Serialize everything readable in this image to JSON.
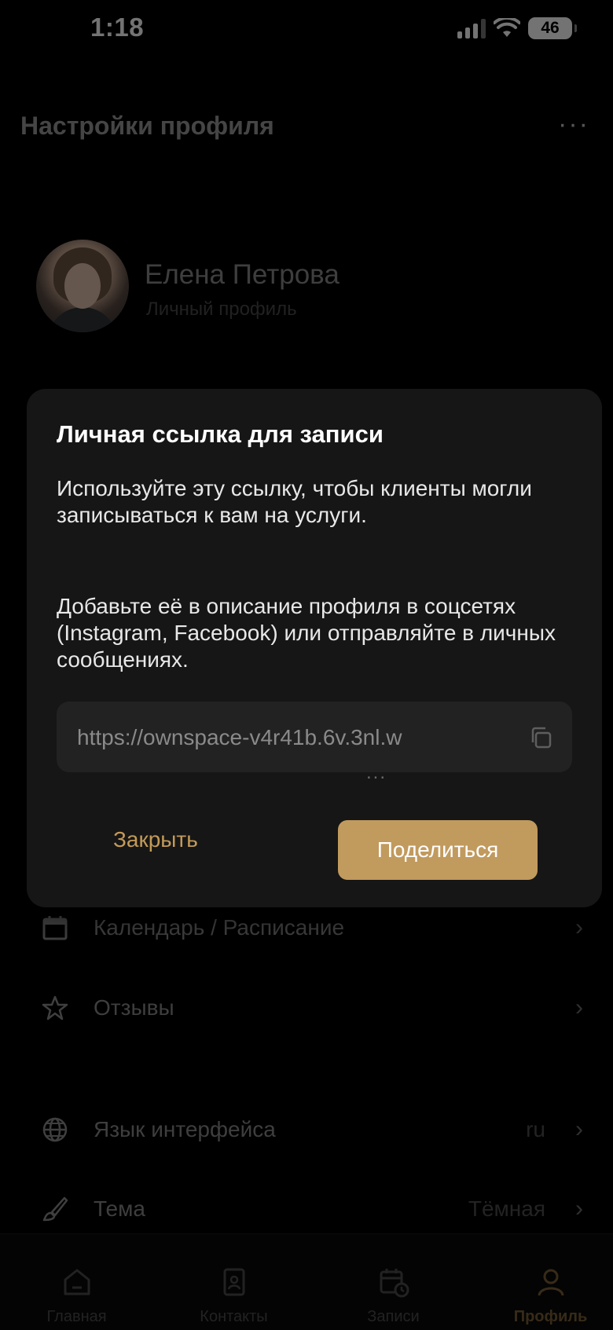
{
  "status": {
    "time": "1:18",
    "battery": "46"
  },
  "header": {
    "title": "Настройки профиля",
    "more": "···"
  },
  "profile": {
    "name": "Елена Петрова",
    "subtitle": "Личный профиль"
  },
  "menu": [
    {
      "label": "Календарь  / Расписание",
      "value": "",
      "icon": "calendar-icon"
    },
    {
      "label": "Отзывы",
      "value": "",
      "icon": "star-icon"
    },
    {
      "label": "Язык интерфейса",
      "value": "ru",
      "icon": "globe-icon"
    },
    {
      "label": "Тема",
      "value": "Тёмная",
      "icon": "brush-icon"
    }
  ],
  "tabs": [
    {
      "label": "Главная",
      "icon": "home-icon"
    },
    {
      "label": "Контакты",
      "icon": "contacts-icon"
    },
    {
      "label": "Записи",
      "icon": "appointments-icon"
    },
    {
      "label": "Профиль",
      "icon": "profile-icon",
      "active": true
    }
  ],
  "modal": {
    "title": "Личная ссылка для записи",
    "text1": "Используйте эту ссылку, чтобы клиенты могли записываться к вам на услуги.",
    "text2": "Добавьте её в описание профиля в соцсетях (Instagram, Facebook) или отправляйте в личных сообщениях.",
    "link": "https://ownspace-v4r41b.6v.3nl.w",
    "link_ellipsis": "...",
    "close_label": "Закрыть",
    "share_label": "Поделиться"
  },
  "colors": {
    "accent": "#c19a5e",
    "background": "#000000",
    "modal": "#161616"
  }
}
